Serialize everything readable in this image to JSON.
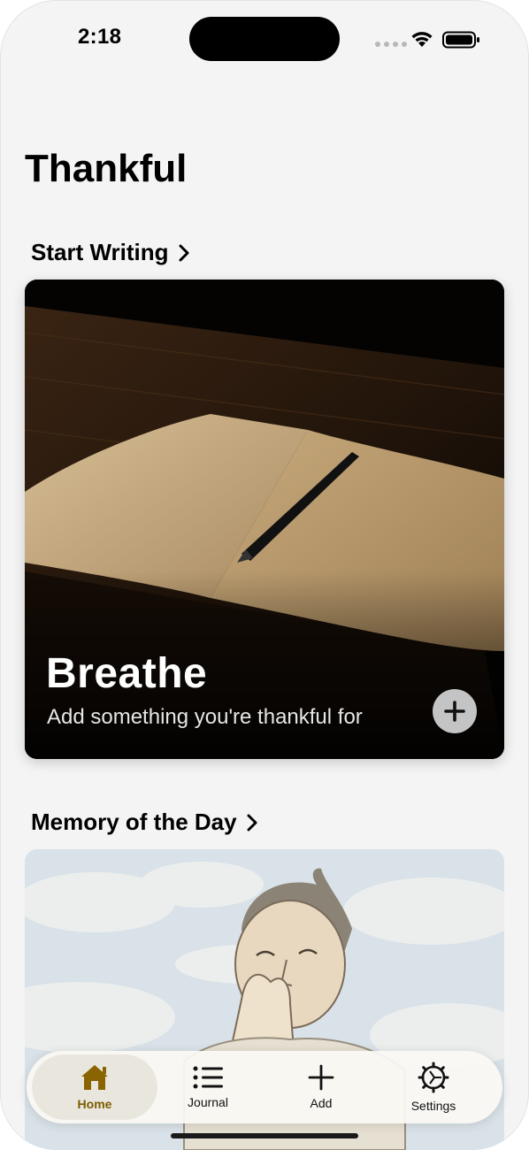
{
  "status_bar": {
    "time": "2:18"
  },
  "page": {
    "title": "Thankful"
  },
  "sections": {
    "start_writing": {
      "label": "Start Writing"
    },
    "memory_of_day": {
      "label": "Memory of the Day"
    }
  },
  "breathe_card": {
    "title": "Breathe",
    "subtitle": "Add something you're thankful for",
    "image": "open-journal-with-pen",
    "action_icon": "plus-icon"
  },
  "memory_card": {
    "image": "sketch-man-praying-clouds"
  },
  "tab_bar": {
    "tabs": [
      {
        "label": "Home",
        "icon": "house-icon",
        "active": true
      },
      {
        "label": "Journal",
        "icon": "list-icon",
        "active": false
      },
      {
        "label": "Add",
        "icon": "plus-icon",
        "active": false
      },
      {
        "label": "Settings",
        "icon": "gear-icon",
        "active": false
      }
    ]
  },
  "colors": {
    "accent": "#7a5a00",
    "background": "#f4f4f4"
  }
}
